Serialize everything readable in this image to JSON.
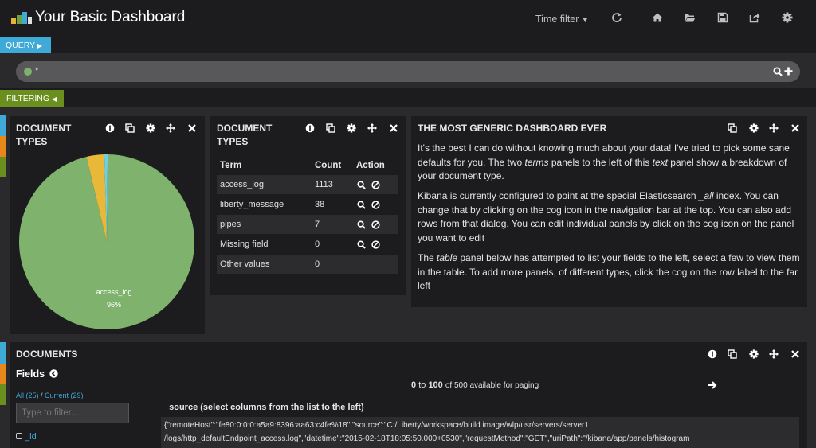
{
  "header": {
    "title": "Your Basic Dashboard",
    "time_filter": "Time filter"
  },
  "query": {
    "tab_label": "QUERY",
    "value": "*"
  },
  "filtering": {
    "tab_label": "FILTERING"
  },
  "panels": {
    "pie": {
      "title_line1": "DOCUMENT",
      "title_line2": "TYPES",
      "slice_label": "access_log",
      "slice_percent": "96%",
      "chart_data": {
        "type": "pie",
        "labels": [
          "access_log",
          "liberty_message",
          "pipes"
        ],
        "values": [
          1113,
          38,
          7
        ],
        "colors": [
          "#7eb26d",
          "#eab839",
          "#6ed0e0"
        ]
      }
    },
    "terms_table": {
      "title_line1": "DOCUMENT",
      "title_line2": "TYPES",
      "col_term": "Term",
      "col_count": "Count",
      "col_action": "Action",
      "rows": [
        {
          "term": "access_log",
          "count": "1113"
        },
        {
          "term": "liberty_message",
          "count": "38"
        },
        {
          "term": "pipes",
          "count": "7"
        },
        {
          "term": "Missing field",
          "count": "0"
        },
        {
          "term": "Other values",
          "count": "0"
        }
      ]
    },
    "text": {
      "title": "THE MOST GENERIC DASHBOARD EVER",
      "p1_a": "It's the best I can do without knowing much about your data! I've tried to pick some sane defaults for you. The two ",
      "p1_em": "terms",
      "p1_b": " panels to the left of this ",
      "p1_em2": "text",
      "p1_c": " panel show a breakdown of your document type.",
      "p2_a": "Kibana is currently configured to point at the special Elasticsearch ",
      "p2_em": "_all",
      "p2_b": " index. You can change that by clicking on the cog icon in the navigation bar at the top. You can also add rows from that dialog. You can edit individual panels by click on the cog icon on the panel you want to edit",
      "p3_a": "The ",
      "p3_em": "table",
      "p3_b": " panel below has attempted to list your fields to the left, select a few to view them in the table. To add more panels, of different types, click the cog on the row label to the far left"
    },
    "documents": {
      "title": "DOCUMENTS",
      "fields_label": "Fields",
      "all_label": "All (25)",
      "separator": " / ",
      "current_label": "Current (29)",
      "filter_placeholder": "Type to filter...",
      "field_item": "_id",
      "paging_from": "0",
      "paging_to_word": "to",
      "paging_to": "100",
      "paging_rest": "of 500 available for paging",
      "source_heading": "_source (select columns from the list to the left)",
      "source_line1": "{\"remoteHost\":\"fe80:0:0:0:a5a9:8396:aa63:c4fe%18\",\"source\":\"C:/Liberty/workspace/build.image/wlp/usr/servers/server1",
      "source_line2": "/logs/http_defaultEndpoint_access.log\",\"datetime\":\"2015-02-18T18:05:50.000+0530\",\"requestMethod\":\"GET\",\"uriPath\":\"/kibana/app/panels/histogram"
    }
  },
  "colors": {
    "query_tab": "#3fa9d8",
    "filter_tab": "#6b8f1e",
    "row_tab_blue": "#3fa9d8",
    "row_tab_orange": "#e8871a",
    "row_tab_green": "#6b8f1e"
  }
}
